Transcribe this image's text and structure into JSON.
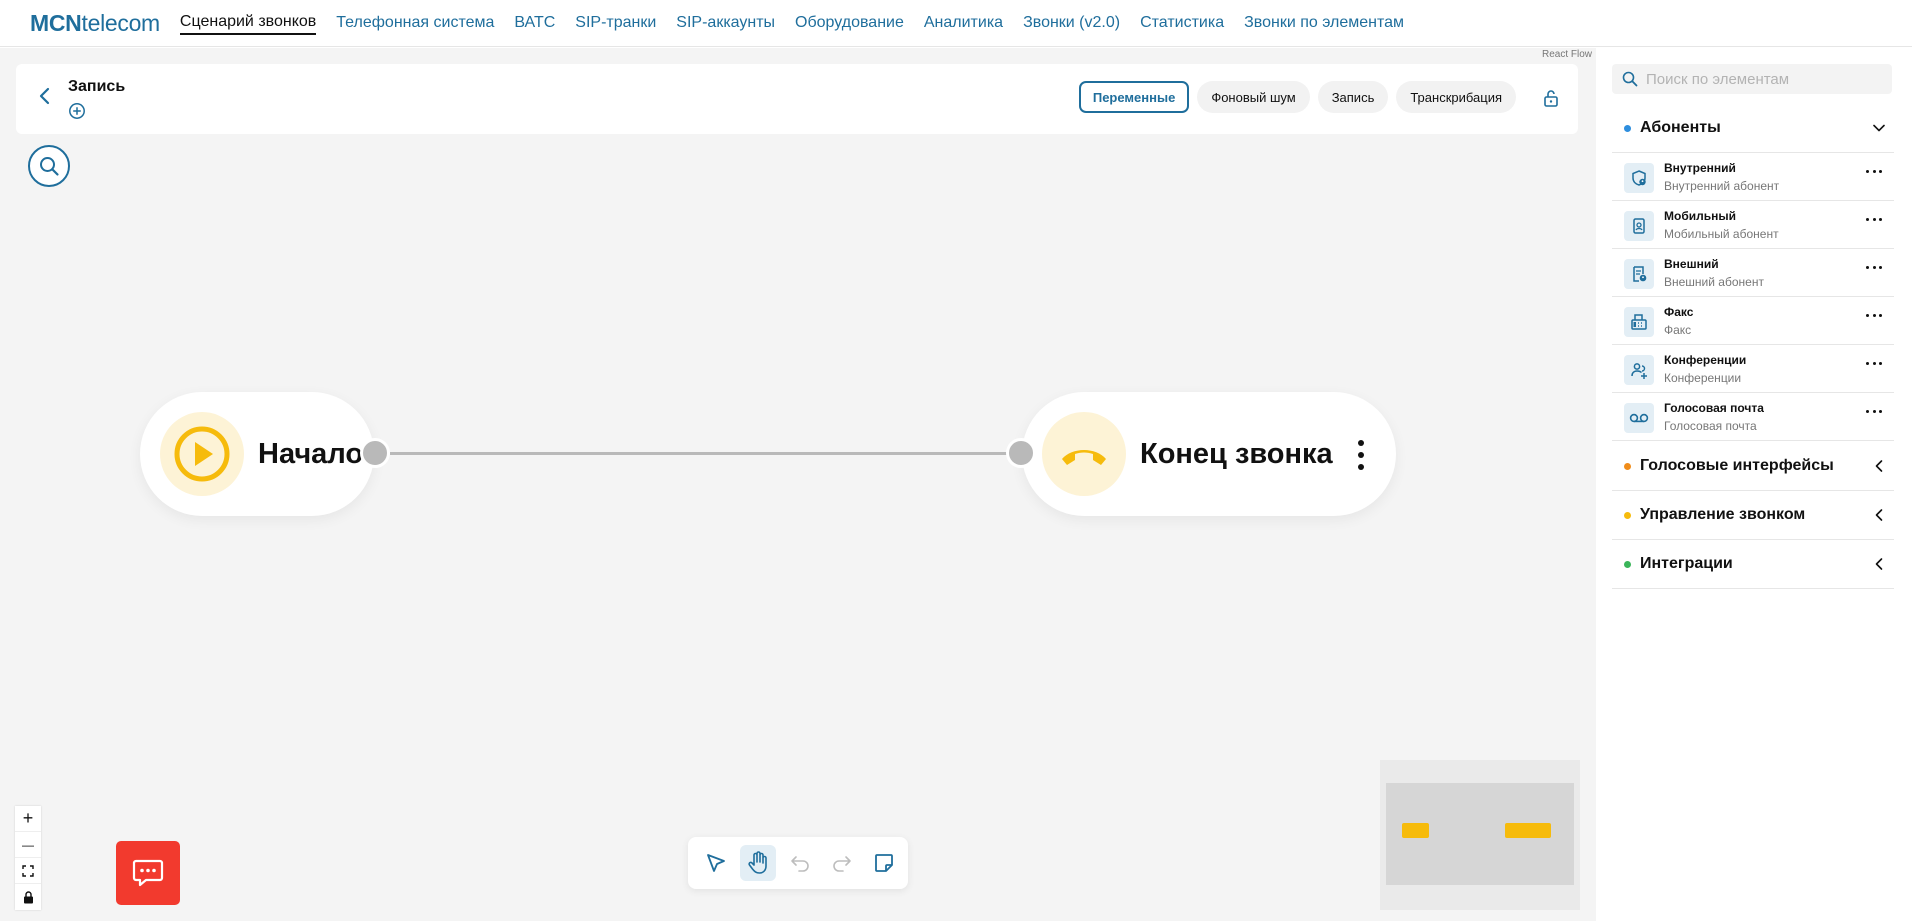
{
  "logo": {
    "bold": "MCN",
    "light": "telecom"
  },
  "nav": [
    {
      "label": "Сценарий звонков",
      "active": true
    },
    {
      "label": "Телефонная система"
    },
    {
      "label": "ВАТС"
    },
    {
      "label": "SIP-транки"
    },
    {
      "label": "SIP-аккаунты"
    },
    {
      "label": "Оборудование"
    },
    {
      "label": "Аналитика"
    },
    {
      "label": "Звонки (v2.0)"
    },
    {
      "label": "Статистика"
    },
    {
      "label": "Звонки по элементам"
    }
  ],
  "canvas": {
    "attribution": "React Flow",
    "scenario_title": "Запись",
    "header_buttons": [
      "Переменные",
      "Фоновый шум",
      "Запись",
      "Транскрибация"
    ],
    "nodes": {
      "start": {
        "label": "Начало"
      },
      "end": {
        "label": "Конец звонка"
      }
    },
    "zoom_controls": {
      "zoom_in": "+",
      "zoom_out": "—"
    }
  },
  "sidebar": {
    "search_placeholder": "Поиск по элементам",
    "groups": [
      {
        "title": "Абоненты",
        "color": "#2e8ede",
        "expanded": true,
        "items": [
          {
            "title": "Внутренний",
            "subtitle": "Внутренний абонент",
            "icon": "internal-subscriber-icon"
          },
          {
            "title": "Мобильный",
            "subtitle": "Мобильный абонент",
            "icon": "mobile-subscriber-icon"
          },
          {
            "title": "Внешний",
            "subtitle": "Внешний абонент",
            "icon": "external-subscriber-icon"
          },
          {
            "title": "Факс",
            "subtitle": "Факс",
            "icon": "fax-icon"
          },
          {
            "title": "Конференции",
            "subtitle": "Конференции",
            "icon": "conference-icon"
          },
          {
            "title": "Голосовая почта",
            "subtitle": "Голосовая почта",
            "icon": "voicemail-icon"
          }
        ]
      },
      {
        "title": "Голосовые интерфейсы",
        "color": "#f08c1a",
        "expanded": false
      },
      {
        "title": "Управление звонком",
        "color": "#f6bb0c",
        "expanded": false
      },
      {
        "title": "Интеграции",
        "color": "#3bb55a",
        "expanded": false
      }
    ]
  },
  "colors": {
    "accent": "#1f6e9c",
    "node_yellow": "#f6bb0c",
    "chat_red": "#f23a2e"
  }
}
